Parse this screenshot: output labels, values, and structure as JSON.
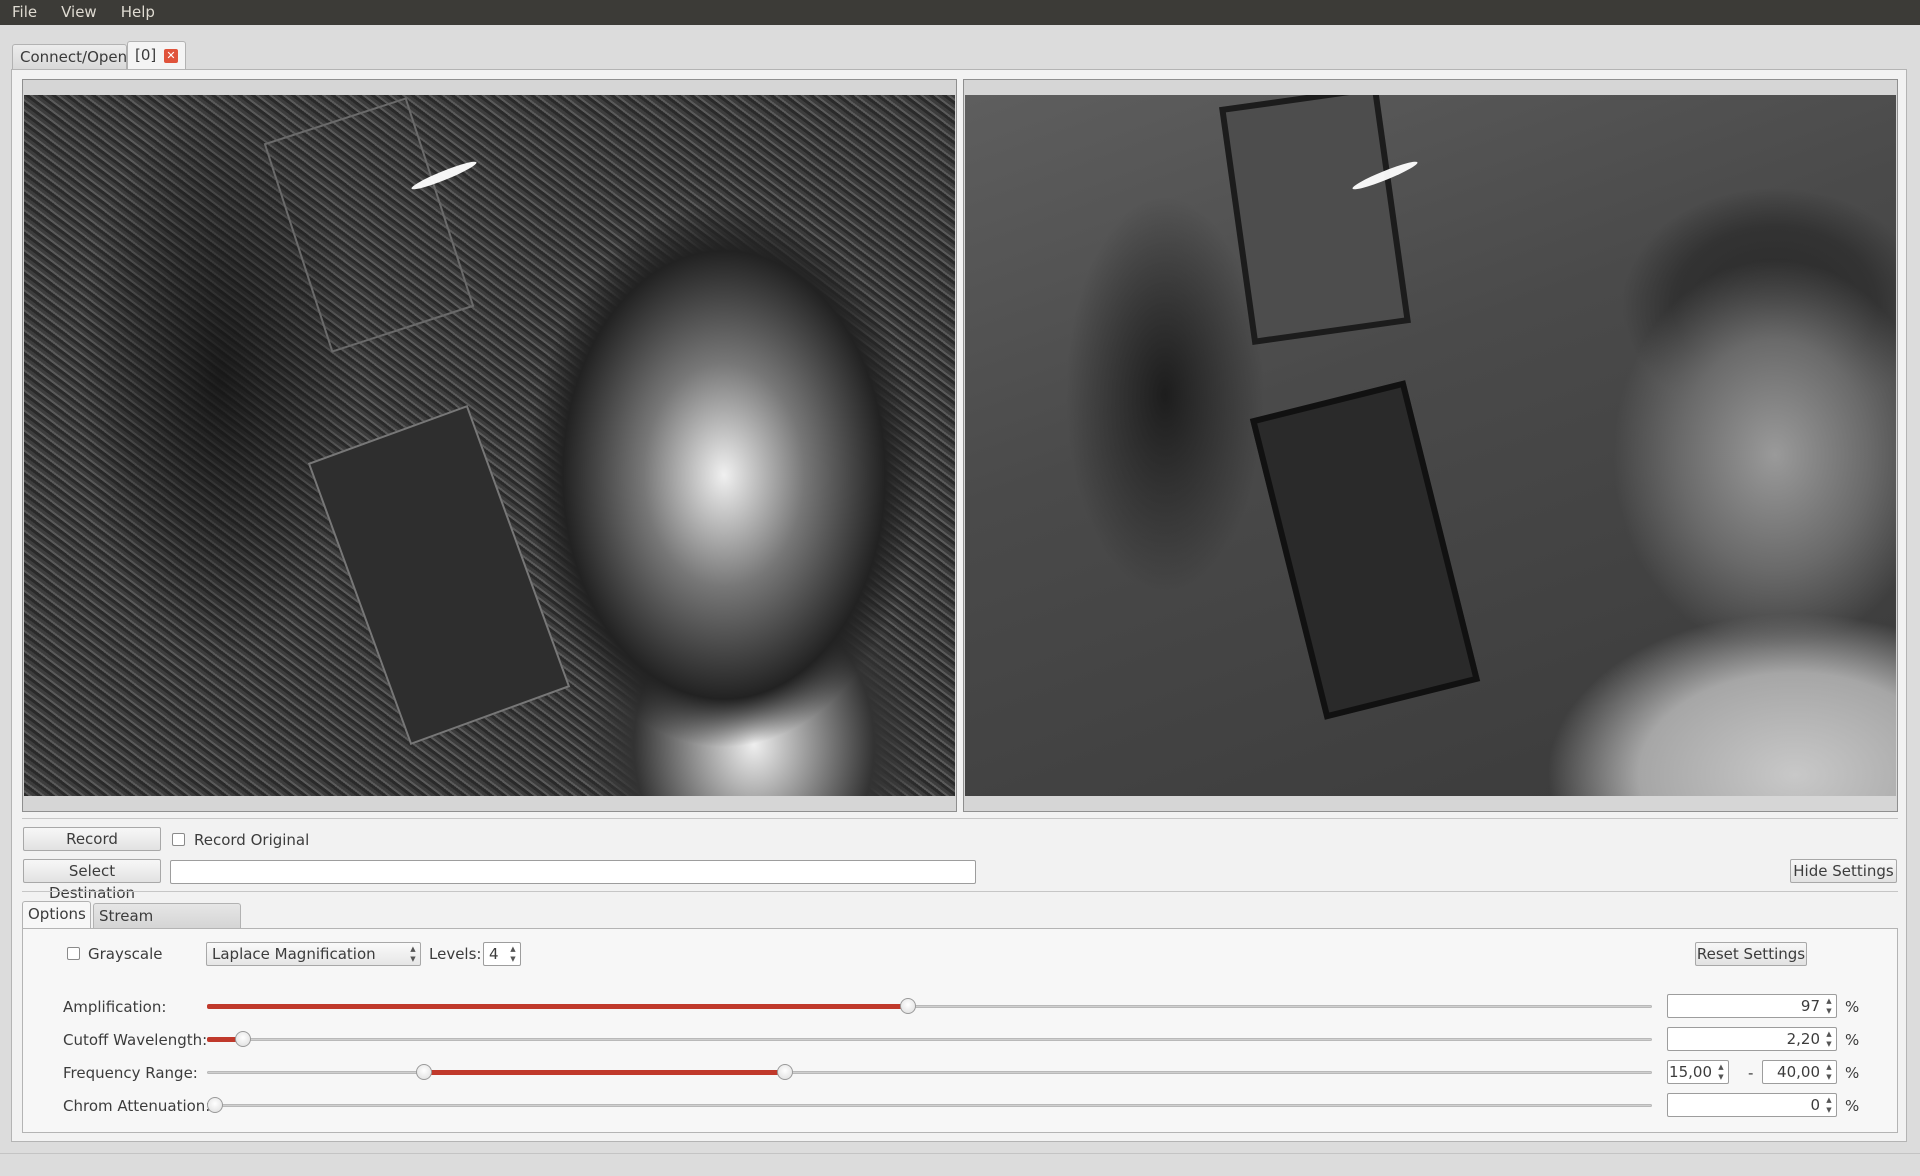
{
  "menu": [
    "File",
    "View",
    "Help"
  ],
  "tabs": {
    "connect": "Connect/Open",
    "stream": "[0]",
    "close_icon": "close-icon"
  },
  "video": {
    "left": "magnified-output-feed",
    "right": "original-feed"
  },
  "record": {
    "record_label": "Record",
    "record_original_label": "Record Original",
    "record_original_checked": false,
    "select_destination_label": "Select Destination",
    "destination_value": "",
    "hide_settings_label": "Hide Settings"
  },
  "settings_tabs": [
    "Options",
    "Stream Information"
  ],
  "options": {
    "grayscale_label": "Grayscale",
    "grayscale_checked": false,
    "mode_value": "Laplace Magnification",
    "levels_label": "Levels:",
    "levels_value": "4",
    "reset_label": "Reset Settings",
    "rows": [
      {
        "label": "Amplification:",
        "value": "97",
        "unit": "%",
        "fraction": 0.485
      },
      {
        "label": "Cutoff Wavelength:",
        "value": "2,20",
        "unit": "%",
        "fraction": 0.025
      },
      {
        "label": "Frequency Range:",
        "low": "15,00",
        "dash": "-",
        "high": "40,00",
        "unit": "%",
        "low_fraction": 0.15,
        "high_fraction": 0.4
      },
      {
        "label": "Chrom Attenuation:",
        "value": "0",
        "unit": "%",
        "fraction": 0.0
      }
    ]
  },
  "colors": {
    "accent": "#c0392b",
    "menubar": "#3c3b37"
  }
}
